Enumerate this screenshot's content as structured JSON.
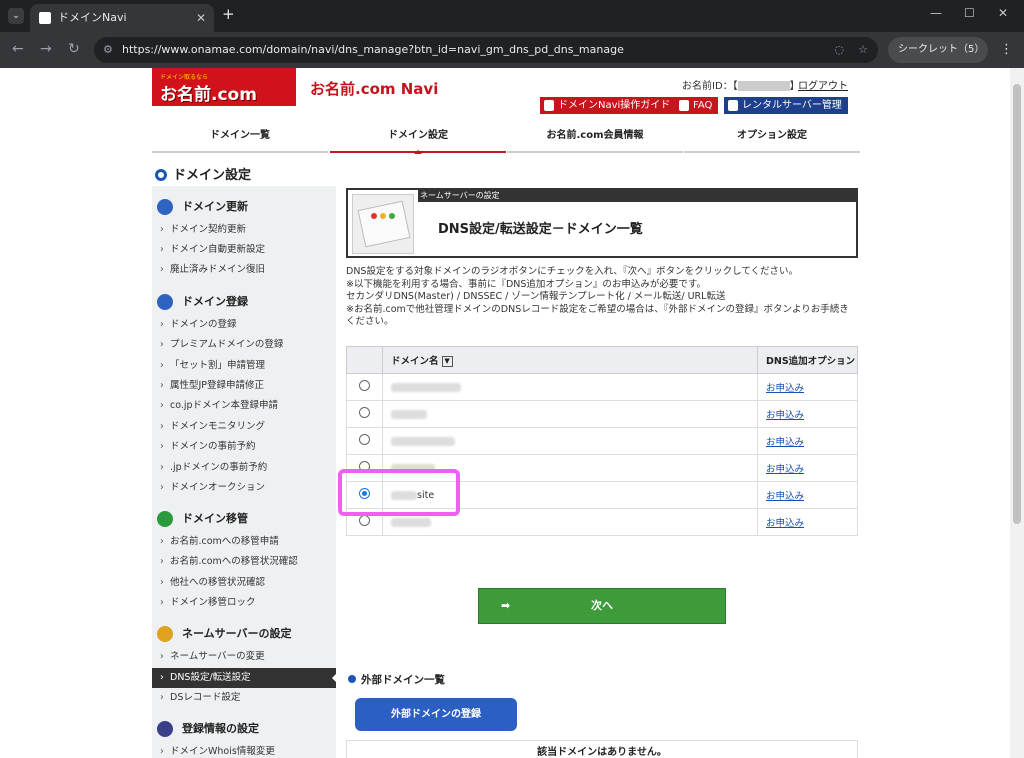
{
  "browser": {
    "tab_title": "ドメインNavi",
    "url": "https://www.onamae.com/domain/navi/dns_manage?btn_id=navi_gm_dns_pd_dns_manage",
    "incognito_label": "シークレット（5）"
  },
  "header": {
    "logo_small": "ドメイン取るなら",
    "logo_main": "お名前.com",
    "app_title": "お名前.com Navi",
    "user_id_label": "お名前ID：【",
    "user_id_end": "】",
    "logout": "ログアウト",
    "buttons": {
      "guide": "ドメインNavi操作ガイド",
      "faq": "FAQ",
      "rental": "レンタルサーバー管理"
    }
  },
  "global_nav": [
    "ドメイン一覧",
    "ドメイン設定",
    "お名前.com会員情報",
    "オプション設定"
  ],
  "section_title": "ドメイン設定",
  "sidebar": {
    "groups": [
      {
        "label": "ドメイン更新",
        "items": [
          "ドメイン契約更新",
          "ドメイン自動更新設定",
          "廃止済みドメイン復旧"
        ]
      },
      {
        "label": "ドメイン登録",
        "items": [
          "ドメインの登録",
          "プレミアムドメインの登録",
          "「セット割」申請管理",
          "属性型JP登録申請修正",
          "co.jpドメイン本登録申請",
          "ドメインモニタリング",
          "ドメインの事前予約",
          ".jpドメインの事前予約",
          "ドメインオークション"
        ]
      },
      {
        "label": "ドメイン移管",
        "items": [
          "お名前.comへの移管申請",
          "お名前.comへの移管状況確認",
          "他社への移管状況確認",
          "ドメイン移管ロック"
        ]
      },
      {
        "label": "ネームサーバーの設定",
        "items": [
          "ネームサーバーの変更",
          "DNS設定/転送設定",
          "DSレコード設定"
        ]
      },
      {
        "label": "登録情報の設定",
        "items": [
          "ドメインWhois情報変更"
        ]
      }
    ],
    "active_item": "DNS設定/転送設定"
  },
  "panel": {
    "caption": "ネームサーバーの設定",
    "title": "DNS設定/転送設定－ドメイン一覧"
  },
  "description": [
    "DNS設定をする対象ドメインのラジオボタンにチェックを入れ、『次へ』ボタンをクリックしてください。",
    "※以下機能を利用する場合、事前に『DNS追加オプション』のお申込みが必要です。",
    "セカンダリDNS(Master) / DNSSEC / ゾーン情報テンプレート化 / メール転送/ URL転送",
    "※お名前.comで他社管理ドメインのDNSレコード設定をご希望の場合は、『外部ドメインの登録』ボタンよりお手続きください。"
  ],
  "table": {
    "headers": {
      "domain": "ドメイン名",
      "sort_icon": "▼",
      "option": "DNS追加オプション"
    },
    "rows": [
      {
        "domain": "",
        "selected": false,
        "option": "お申込み"
      },
      {
        "domain": "",
        "selected": false,
        "option": "お申込み"
      },
      {
        "domain": "",
        "selected": false,
        "option": "お申込み"
      },
      {
        "domain": "",
        "selected": false,
        "option": "お申込み"
      },
      {
        "domain": "site",
        "selected": true,
        "option": "お申込み"
      },
      {
        "domain": "",
        "selected": false,
        "option": "お申込み"
      }
    ]
  },
  "next_button": "次へ",
  "external": {
    "title": "外部ドメイン一覧",
    "register_button": "外部ドメインの登録",
    "empty_message": "該当ドメインはありません。"
  },
  "colors": {
    "brand_red": "#d2121b",
    "nav_blue": "#1a57b5",
    "next_green": "#3e9b39",
    "highlight": "#f25ef2"
  }
}
